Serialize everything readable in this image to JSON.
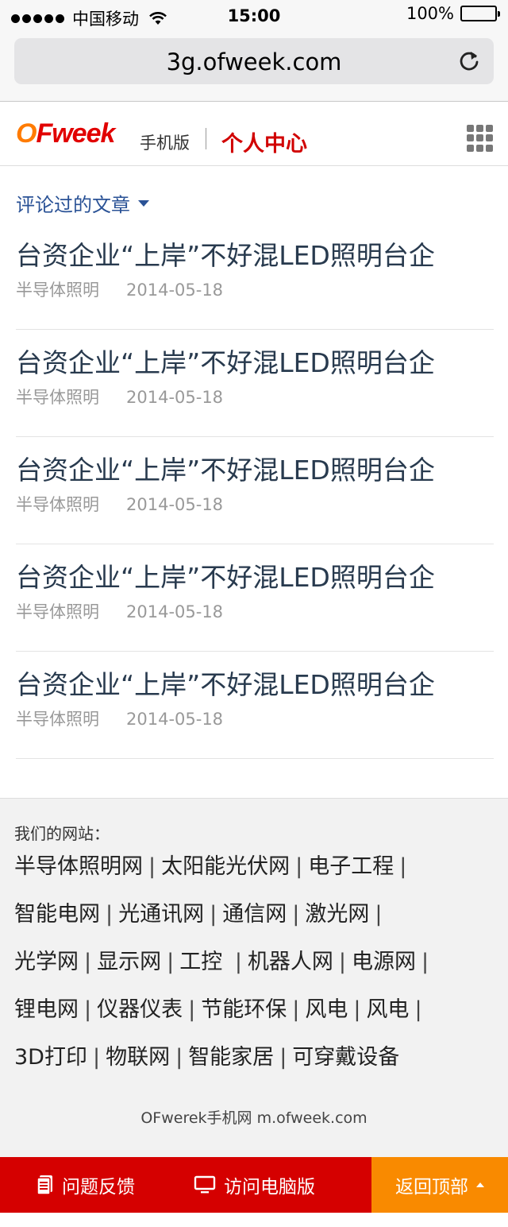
{
  "status_bar": {
    "carrier": "中国移动",
    "time": "15:00",
    "battery": "100%",
    "battery_level": 1.0
  },
  "browser": {
    "url": "3g.ofweek.com",
    "reload_icon": "reload-icon"
  },
  "header": {
    "logo": "OFweek",
    "logo_sub": "手机版",
    "title": "个人中心",
    "menu_icon": "grid-menu-icon"
  },
  "section": {
    "dropdown_label": "评论过的文章"
  },
  "articles": [
    {
      "title": "台资企业“上岸”不好混LED照明台企",
      "category": "半导体照明",
      "date": "2014-05-18"
    },
    {
      "title": "台资企业“上岸”不好混LED照明台企",
      "category": "半导体照明",
      "date": "2014-05-18"
    },
    {
      "title": "台资企业“上岸”不好混LED照明台企",
      "category": "半导体照明",
      "date": "2014-05-18"
    },
    {
      "title": "台资企业“上岸”不好混LED照明台企",
      "category": "半导体照明",
      "date": "2014-05-18"
    },
    {
      "title": "台资企业“上岸”不好混LED照明台企",
      "category": "半导体照明",
      "date": "2014-05-18"
    }
  ],
  "footer": {
    "label": "我们的网站：",
    "link_rows": [
      [
        "半导体照明网",
        "太阳能光伏网",
        "电子工程"
      ],
      [
        "智能电网",
        "光通讯网",
        "通信网",
        "激光网"
      ],
      [
        "光学网",
        "显示网",
        "工控 ",
        "机器人网",
        "电源网"
      ],
      [
        "锂电网",
        "仪器仪表",
        "节能环保",
        "风电",
        "风电"
      ],
      [
        "3D打印",
        "物联网",
        "智能家居",
        "可穿戴设备"
      ]
    ],
    "trailing_separator_rows": [
      0,
      1,
      2,
      3
    ],
    "brand": "OFwerek手机网 m.ofweek.com"
  },
  "bottom_bar": {
    "feedback": "问题反馈",
    "pc_version": "访问电脑版",
    "back_to_top": "返回顶部"
  },
  "colors": {
    "brand_red": "#d50000",
    "back_to_top_orange": "#f98a00",
    "link_blue": "#2a5296",
    "title_text": "#283a4e"
  }
}
